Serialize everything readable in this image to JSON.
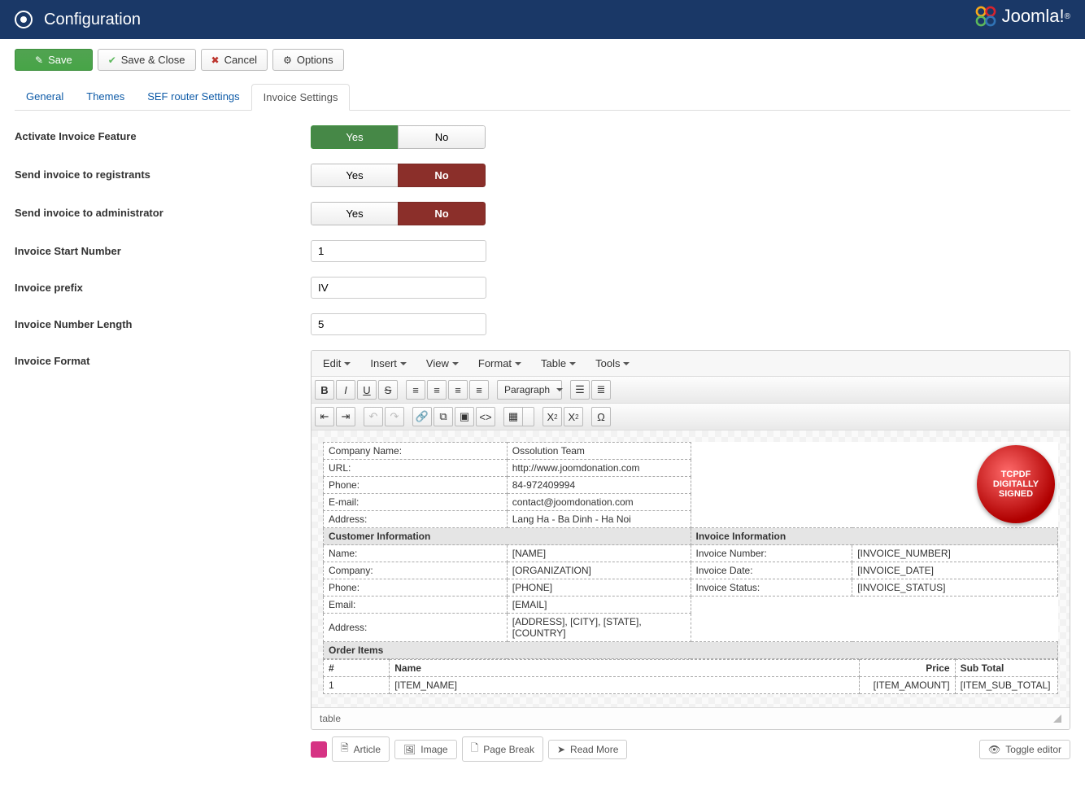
{
  "header": {
    "title": "Configuration",
    "brand": "Joomla!"
  },
  "toolbar": {
    "save": "Save",
    "save_close": "Save & Close",
    "cancel": "Cancel",
    "options": "Options"
  },
  "tabs": {
    "general": "General",
    "themes": "Themes",
    "sef": "SEF router Settings",
    "invoice": "Invoice Settings"
  },
  "form": {
    "activate_label": "Activate Invoice Feature",
    "send_registrants_label": "Send invoice to registrants",
    "send_admin_label": "Send invoice to administrator",
    "start_number_label": "Invoice Start Number",
    "start_number_value": "1",
    "prefix_label": "Invoice prefix",
    "prefix_value": "IV",
    "number_length_label": "Invoice Number Length",
    "number_length_value": "5",
    "format_label": "Invoice Format",
    "yes": "Yes",
    "no": "No"
  },
  "editor": {
    "menus": {
      "edit": "Edit",
      "insert": "Insert",
      "view": "View",
      "format": "Format",
      "table": "Table",
      "tools": "Tools"
    },
    "paragraph": "Paragraph",
    "statusbar_path": "table",
    "seal": {
      "line1": "TCPDF",
      "line2": "DIGITALLY",
      "line3": "SIGNED"
    },
    "bottom_buttons": {
      "article": "Article",
      "image": "Image",
      "pagebreak": "Page Break",
      "readmore": "Read More",
      "toggle": "Toggle editor"
    }
  },
  "invoice_template": {
    "company": {
      "name_label": "Company Name:",
      "name_value": "Ossolution Team",
      "url_label": "URL:",
      "url_value": "http://www.joomdonation.com",
      "phone_label": "Phone:",
      "phone_value": "84-972409994",
      "email_label": "E-mail:",
      "email_value": "contact@joomdonation.com",
      "address_label": "Address:",
      "address_value": "Lang Ha - Ba Dinh - Ha Noi"
    },
    "customer_header": "Customer Information",
    "customer": {
      "name_label": "Name:",
      "name_value": "[NAME]",
      "company_label": "Company:",
      "company_value": "[ORGANIZATION]",
      "phone_label": "Phone:",
      "phone_value": "[PHONE]",
      "email_label": "Email:",
      "email_value": "[EMAIL]",
      "address_label": "Address:",
      "address_value": "[ADDRESS], [CITY], [STATE], [COUNTRY]"
    },
    "invoice_info_header": "Invoice Information",
    "invoice_info": {
      "number_label": "Invoice Number:",
      "number_value": "[INVOICE_NUMBER]",
      "date_label": "Invoice Date:",
      "date_value": "[INVOICE_DATE]",
      "status_label": "Invoice Status:",
      "status_value": "[INVOICE_STATUS]"
    },
    "order_items_header": "Order Items",
    "order_cols": {
      "num": "#",
      "name": "Name",
      "price": "Price",
      "subtotal": "Sub Total"
    },
    "order_row": {
      "num": "1",
      "name": "[ITEM_NAME]",
      "price": "[ITEM_AMOUNT]",
      "subtotal": "[ITEM_SUB_TOTAL]"
    }
  }
}
